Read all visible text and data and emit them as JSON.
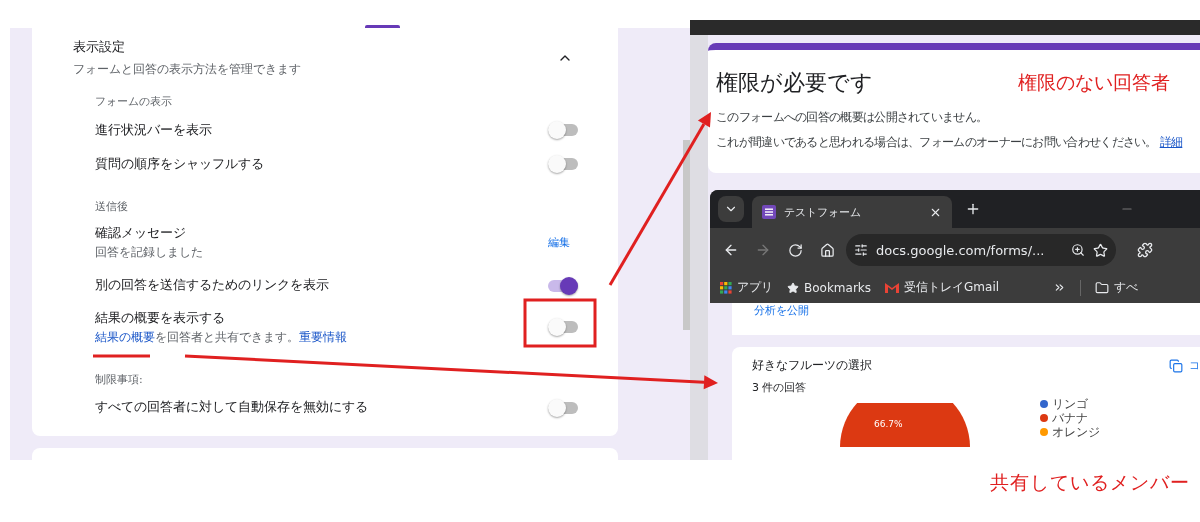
{
  "settings_panel": {
    "title": "表示設定",
    "subtitle": "フォームと回答の表示方法を管理できます",
    "expanded": true,
    "sections": [
      {
        "heading": "フォームの表示",
        "rows": [
          {
            "kind": "toggle",
            "label": "進行状況バーを表示",
            "on": false
          },
          {
            "kind": "toggle",
            "label": "質問の順序をシャッフルする",
            "on": false
          }
        ]
      },
      {
        "heading": "送信後",
        "rows": [
          {
            "kind": "action",
            "label": "確認メッセージ",
            "description": [
              {
                "text": "回答を記録しました",
                "link": false
              }
            ],
            "action": "編集"
          },
          {
            "kind": "toggle",
            "label": "別の回答を送信するためのリンクを表示",
            "on": true
          },
          {
            "kind": "toggle",
            "label": "結果の概要を表示する",
            "description": [
              {
                "text": "結果の概要",
                "link": true
              },
              {
                "text": "を回答者と共有できます。",
                "link": false
              },
              {
                "text": "重要情報",
                "link": true
              }
            ],
            "on": false
          }
        ]
      },
      {
        "heading": "制限事項:",
        "rows": [
          {
            "kind": "toggle",
            "label": "すべての回答者に対して自動保存を無効にする",
            "on": false
          }
        ]
      }
    ]
  },
  "permission_card": {
    "title": "権限が必要です",
    "note": "権限のない回答者",
    "lines": [
      "このフォームへの回答の概要は公開されていません。",
      "これが間違いであると思われる場合は、フォームのオーナーにお問い合わせください。"
    ],
    "link": "詳細"
  },
  "browser": {
    "tab_title": "テストフォーム",
    "url": "docs.google.com/forms/...",
    "bookmarks": [
      {
        "kind": "apps",
        "label": "アプリ"
      },
      {
        "kind": "star",
        "label": "Bookmarks"
      },
      {
        "kind": "mail",
        "label": "受信トレイGmail"
      }
    ],
    "folder": "すべ"
  },
  "summary_link": "分析を公開",
  "question_card": {
    "title": "好きなフルーツの選択",
    "count": "3 件の回答",
    "copy_label": "コ",
    "pie_label": "66.7%",
    "legend": [
      {
        "label": "リンゴ",
        "color": "#3366cc"
      },
      {
        "label": "バナナ",
        "color": "#dc3912"
      },
      {
        "label": "オレンジ",
        "color": "#ff9900"
      }
    ]
  },
  "bottom_note": "共有しているメンバー"
}
